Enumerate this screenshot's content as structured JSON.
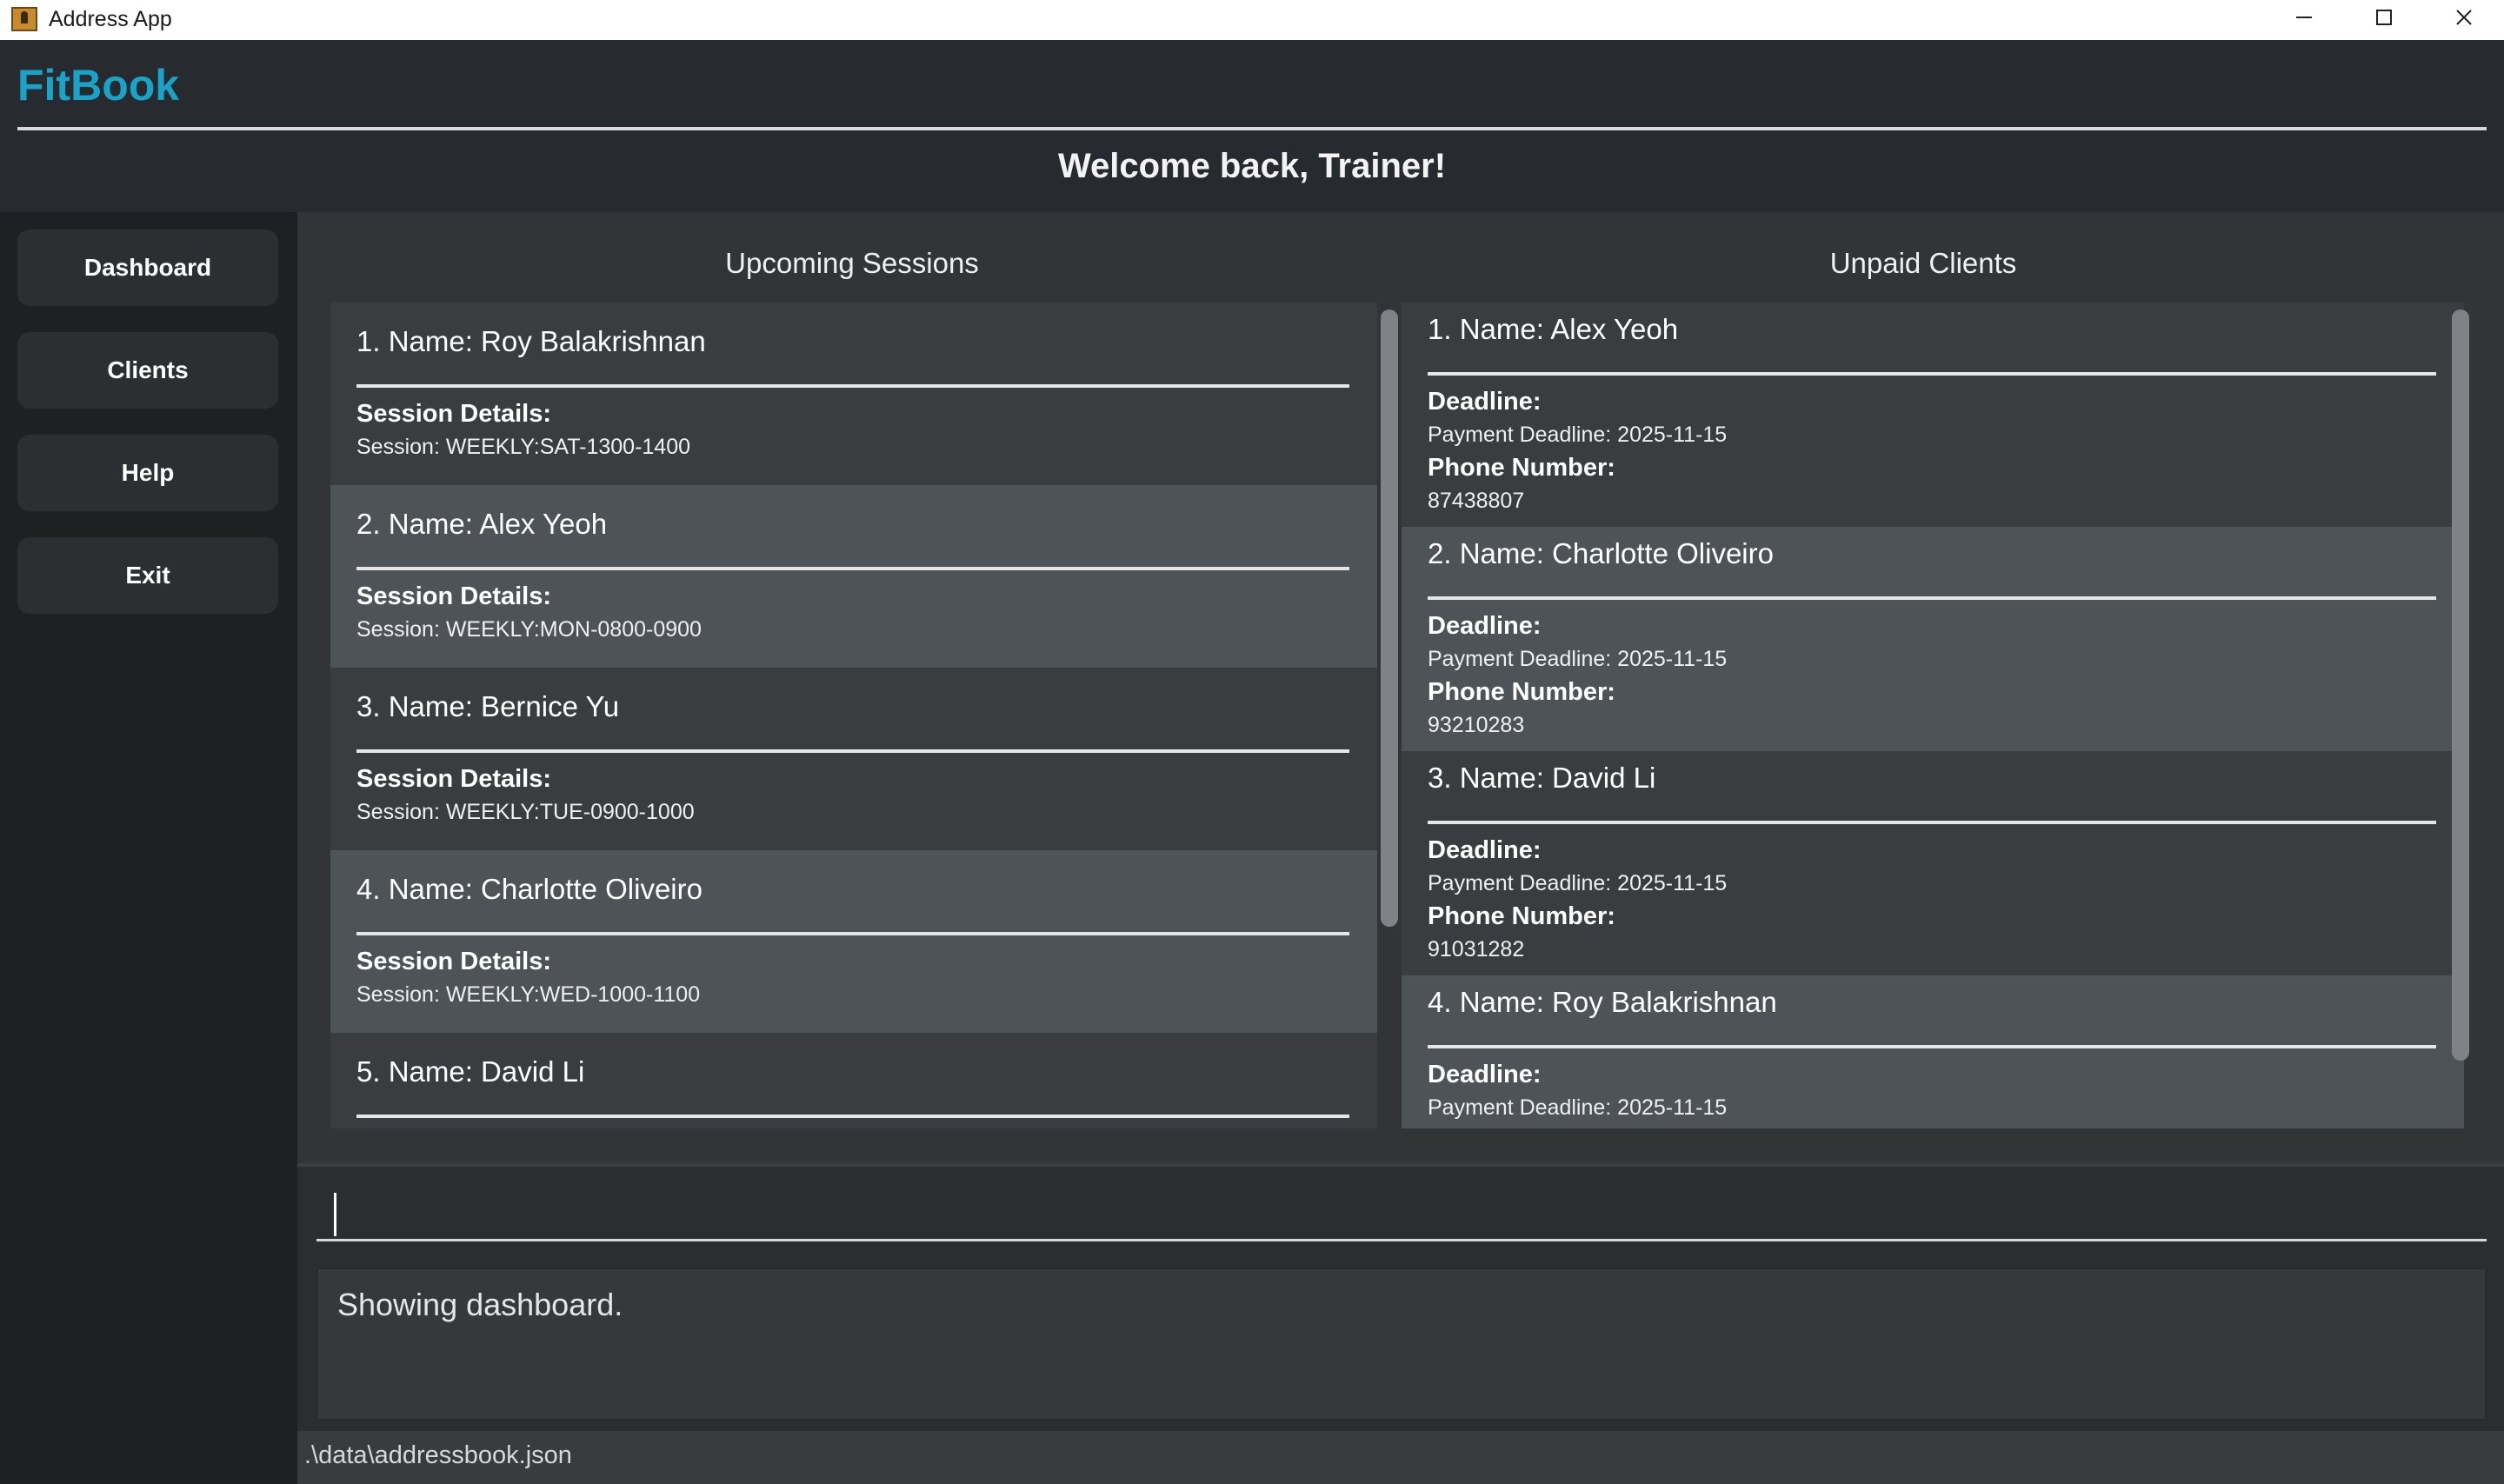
{
  "window": {
    "title": "Address App",
    "controls": [
      "minimize-icon",
      "maximize-icon",
      "close-icon"
    ]
  },
  "header": {
    "brand": "FitBook",
    "welcome": "Welcome back, Trainer!"
  },
  "sidebar": {
    "items": [
      {
        "label": "Dashboard"
      },
      {
        "label": "Clients"
      },
      {
        "label": "Help"
      },
      {
        "label": "Exit"
      }
    ]
  },
  "sessions": {
    "title": "Upcoming Sessions",
    "detail_label": "Session Details:",
    "items": [
      {
        "name": "1. Name: Roy Balakrishnan",
        "session": "Session: WEEKLY:SAT-1300-1400"
      },
      {
        "name": "2. Name: Alex Yeoh",
        "session": "Session: WEEKLY:MON-0800-0900"
      },
      {
        "name": "3. Name: Bernice Yu",
        "session": "Session: WEEKLY:TUE-0900-1000"
      },
      {
        "name": "4. Name: Charlotte Oliveiro",
        "session": "Session: WEEKLY:WED-1000-1100"
      },
      {
        "name": "5. Name: David Li",
        "session": ""
      }
    ]
  },
  "unpaid": {
    "title": "Unpaid Clients",
    "deadline_label": "Deadline:",
    "phone_label": "Phone Number:",
    "items": [
      {
        "name": "1. Name: Alex Yeoh",
        "deadline": "Payment Deadline: 2025-11-15",
        "phone": "87438807"
      },
      {
        "name": "2. Name: Charlotte Oliveiro",
        "deadline": "Payment Deadline: 2025-11-15",
        "phone": "93210283"
      },
      {
        "name": "3. Name: David Li",
        "deadline": "Payment Deadline: 2025-11-15",
        "phone": "91031282"
      },
      {
        "name": "4. Name: Roy Balakrishnan",
        "deadline": "Payment Deadline: 2025-11-15",
        "phone": ""
      }
    ]
  },
  "command": {
    "value": ""
  },
  "result": {
    "text": "Showing dashboard."
  },
  "status": {
    "path": ".\\data\\addressbook.json"
  },
  "colors": {
    "brand": "#1aa3c9",
    "background": "#2b2d30",
    "card_alt": "#4e5357"
  }
}
